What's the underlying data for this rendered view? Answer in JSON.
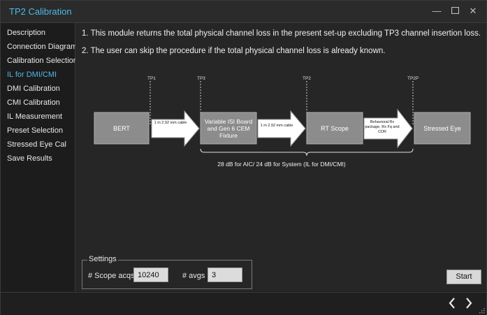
{
  "window": {
    "title": "TP2 Calibration",
    "minimize_icon": "minimize-icon",
    "maximize_icon": "maximize-icon",
    "close_icon": "close-icon"
  },
  "sidebar": {
    "items": [
      {
        "label": "Description"
      },
      {
        "label": "Connection Diagram"
      },
      {
        "label": "Calibration Selection"
      },
      {
        "label": "IL for DMI/CMI",
        "active": true
      },
      {
        "label": "DMI Calibration"
      },
      {
        "label": "CMI Calibration"
      },
      {
        "label": "IL Measurement"
      },
      {
        "label": "Preset Selection"
      },
      {
        "label": "Stressed Eye Cal"
      },
      {
        "label": "Save Results"
      }
    ]
  },
  "main": {
    "instructions": [
      "1. This module returns the total physical channel loss in the present set-up excluding TP3 channel insertion loss.",
      "2. The user can skip the procedure if the total physical channel loss is already known."
    ],
    "diagram": {
      "tp_labels": [
        "TP1",
        "TP3",
        "TP2",
        "TP2P"
      ],
      "blocks": [
        "BERT",
        "Variable ISI Board and Gen 6 CEM Fixture",
        "RT Scope",
        "Stressed Eye"
      ],
      "arrows": [
        "1 m 2.92 mm cable",
        "1 m 2.92 mm cable",
        "Behavioral Rx package, Rx Fq and CDR"
      ],
      "brace_label": "28 dB for AIC/ 24 dB for System (IL for DMI/CMI)"
    },
    "settings": {
      "legend": "Settings",
      "scope_acqs_label": "# Scope acqs",
      "scope_acqs_value": "10240",
      "avgs_label": "# avgs",
      "avgs_value": "3"
    },
    "start_label": "Start"
  },
  "footer": {
    "back_icon": "chevron-left-icon",
    "forward_icon": "chevron-right-icon"
  },
  "colors": {
    "accent": "#4fb8e8",
    "block_fill": "#8c8c8c",
    "arrow_fill": "#ffffff"
  }
}
